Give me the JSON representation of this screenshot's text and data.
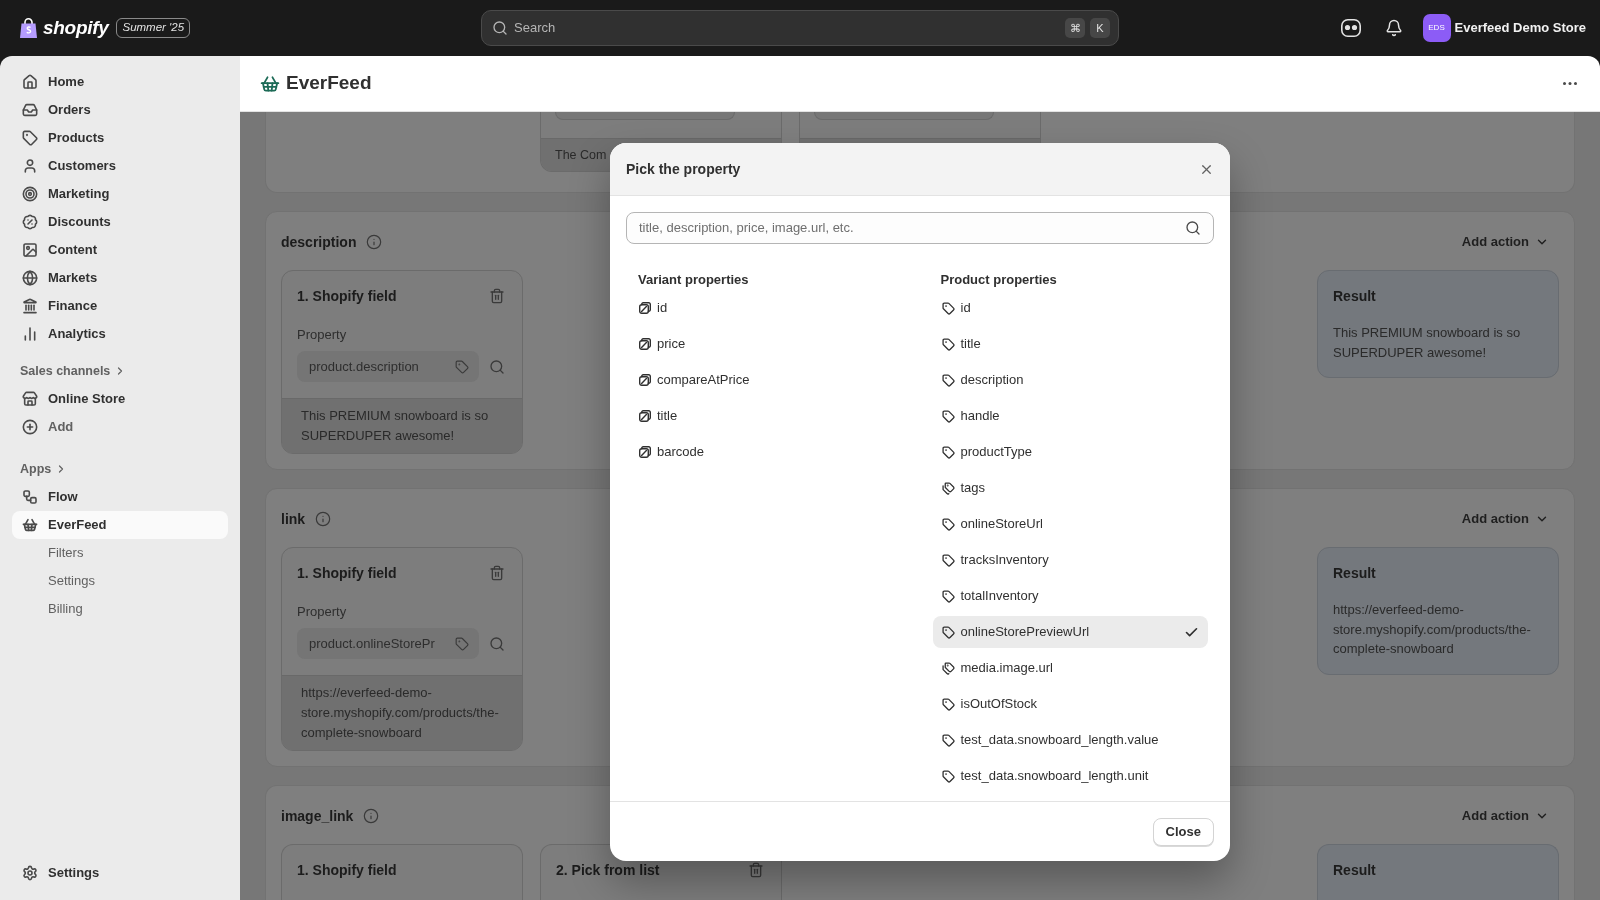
{
  "top_bar": {
    "logo": "shopify",
    "edition": "Summer '25",
    "search": {
      "placeholder": "Search",
      "shortcut": [
        "⌘",
        "K"
      ]
    },
    "store": {
      "initials": "EDS",
      "name": "Everfeed Demo Store"
    }
  },
  "sidebar": {
    "items": [
      {
        "label": "Home",
        "selected": false
      },
      {
        "label": "Orders",
        "selected": false
      },
      {
        "label": "Products",
        "selected": false
      },
      {
        "label": "Customers",
        "selected": false
      },
      {
        "label": "Marketing",
        "selected": false
      },
      {
        "label": "Discounts",
        "selected": false
      },
      {
        "label": "Content",
        "selected": false
      },
      {
        "label": "Markets",
        "selected": false
      },
      {
        "label": "Finance",
        "selected": false
      },
      {
        "label": "Analytics",
        "selected": false
      }
    ],
    "sections": [
      {
        "title": "Sales channels",
        "items": [
          {
            "label": "Online Store",
            "kind": "channel",
            "selected": false
          },
          {
            "label": "Add",
            "kind": "add",
            "selected": false
          }
        ]
      },
      {
        "title": "Apps",
        "items": [
          {
            "label": "Flow",
            "kind": "app",
            "selected": false
          },
          {
            "label": "EverFeed",
            "kind": "app",
            "selected": true,
            "children": [
              {
                "label": "Filters",
                "selected": false
              },
              {
                "label": "Settings",
                "selected": false
              },
              {
                "label": "Billing",
                "selected": false
              }
            ]
          }
        ]
      }
    ],
    "footer": {
      "label": "Settings",
      "selected": false
    }
  },
  "app_header": {
    "title": "EverFeed"
  },
  "mappings": [
    {
      "kind": "cut_top",
      "steps": [
        {
          "kind": "stub",
          "preview": "The Com"
        },
        {
          "kind": "stub"
        }
      ]
    },
    {
      "kind": "full",
      "name": "description",
      "action": "Add action",
      "steps": [
        {
          "kind": "field",
          "title": "1. Shopify field",
          "removable": true,
          "label": "Property",
          "value": "product.description",
          "preview": "This PREMIUM snowboard is so SUPERDUPER awesome!"
        }
      ],
      "result": {
        "title": "Result",
        "text": "This PREMIUM snowboard is so SUPERDUPER awesome!"
      }
    },
    {
      "kind": "full",
      "name": "link",
      "action": "Add action",
      "steps": [
        {
          "kind": "field",
          "title": "1. Shopify field",
          "removable": true,
          "label": "Property",
          "value": "product.onlineStorePr",
          "preview": "https://everfeed-demo-store.myshopify.com/products/the-complete-snowboard"
        }
      ],
      "result": {
        "title": "Result",
        "text": "https://everfeed-demo-store.myshopify.com/products/the-complete-snowboard"
      }
    },
    {
      "kind": "cut_bottom",
      "name": "image_link",
      "action": "Add action",
      "steps": [
        {
          "kind": "field",
          "title": "1. Shopify field",
          "removable": false
        },
        {
          "kind": "field",
          "title": "2. Pick from list",
          "removable": true
        }
      ],
      "result": {
        "title": "Result"
      }
    }
  ],
  "dialog": {
    "title": "Pick the property",
    "search": {
      "placeholder": "title, description, price, image.url, etc."
    },
    "groups": [
      {
        "title": "Variant properties",
        "items": [
          {
            "label": "id",
            "kind": "variant",
            "selected": false
          },
          {
            "label": "price",
            "kind": "variant",
            "selected": false
          },
          {
            "label": "compareAtPrice",
            "kind": "variant",
            "selected": false
          },
          {
            "label": "title",
            "kind": "variant",
            "selected": false
          },
          {
            "label": "barcode",
            "kind": "variant",
            "selected": false
          }
        ]
      },
      {
        "title": "Product properties",
        "items": [
          {
            "label": "id",
            "kind": "field",
            "selected": false
          },
          {
            "label": "title",
            "kind": "field",
            "selected": false
          },
          {
            "label": "description",
            "kind": "field",
            "selected": false
          },
          {
            "label": "handle",
            "kind": "field",
            "selected": false
          },
          {
            "label": "productType",
            "kind": "field",
            "selected": false
          },
          {
            "label": "tags",
            "kind": "list",
            "selected": false
          },
          {
            "label": "onlineStoreUrl",
            "kind": "field",
            "selected": false
          },
          {
            "label": "tracksInventory",
            "kind": "field",
            "selected": false
          },
          {
            "label": "totalInventory",
            "kind": "field",
            "selected": false
          },
          {
            "label": "onlineStorePreviewUrl",
            "kind": "field",
            "selected": true
          },
          {
            "label": "media.image.url",
            "kind": "list",
            "selected": false
          },
          {
            "label": "isOutOfStock",
            "kind": "field",
            "selected": false
          },
          {
            "label": "test_data.snowboard_length.value",
            "kind": "field",
            "selected": false
          },
          {
            "label": "test_data.snowboard_length.unit",
            "kind": "field",
            "selected": false
          }
        ]
      }
    ],
    "close_button": "Close"
  }
}
